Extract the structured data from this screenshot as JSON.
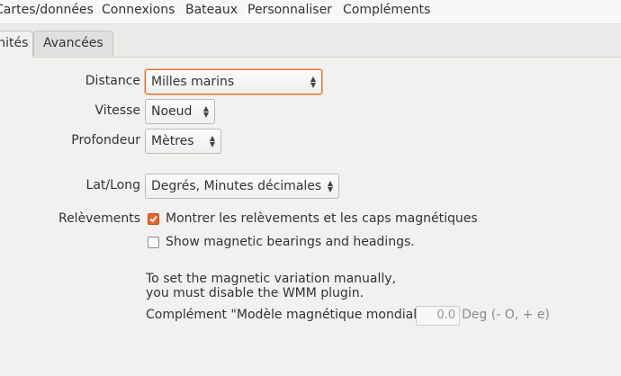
{
  "menu": {
    "tabs": [
      {
        "label": "Cartes/données"
      },
      {
        "label": "Connexions"
      },
      {
        "label": "Bateaux"
      },
      {
        "label": "Personnaliser"
      },
      {
        "label": "Compléments"
      }
    ]
  },
  "subtabs": {
    "active_label": "Unités",
    "advanced_label": "Avancées"
  },
  "units": {
    "distance": {
      "label": "Distance",
      "value": "Milles marins"
    },
    "speed": {
      "label": "Vitesse",
      "value": "Noeud"
    },
    "depth": {
      "label": "Profondeur",
      "value": "Mètres"
    },
    "latlong": {
      "label": "Lat/Long",
      "value": "Degrés, Minutes décimales"
    }
  },
  "bearings": {
    "label": "Relèvements",
    "show_magnetic": {
      "label": "Montrer les relèvements et les caps magnétiques",
      "checked": true
    },
    "show_magnetic_en": {
      "label": "Show magnetic bearings and headings.",
      "checked": false
    }
  },
  "variation": {
    "note_line1": "To set the magnetic variation manually,",
    "note_line2": "you must disable the WMM plugin.",
    "plugin_label": "Complément \"Modèle magnétique mondial\"",
    "value": "0.0",
    "unit": "Deg (- O, + e)"
  },
  "colors": {
    "accent": "#e7652b",
    "focus_border": "#e1702e"
  }
}
